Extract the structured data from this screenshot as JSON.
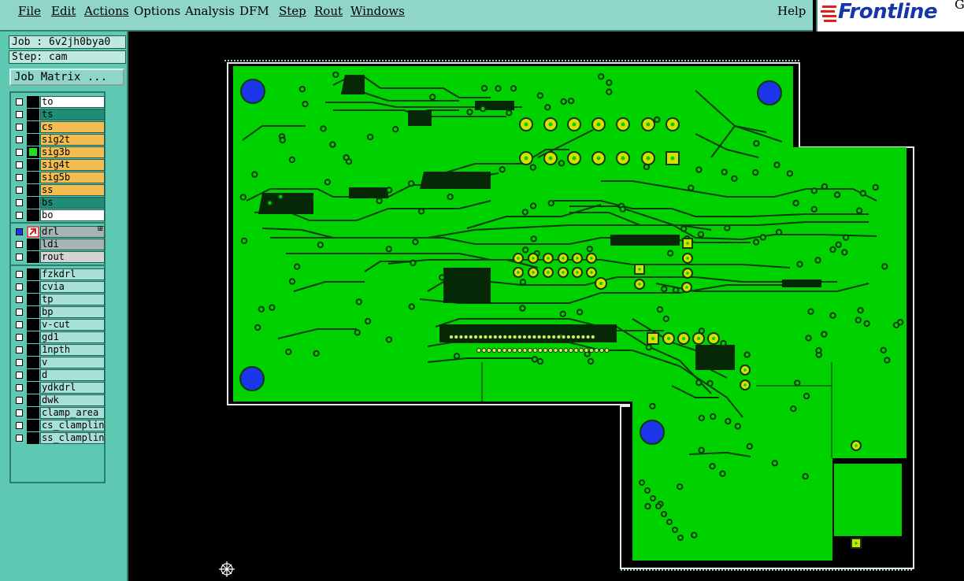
{
  "menu": {
    "file": "File",
    "edit": "Edit",
    "actions": "Actions",
    "options": "Options",
    "analysis": "Analysis",
    "dfm": "DFM",
    "step": "Step",
    "rout": "Rout",
    "windows": "Windows",
    "help": "Help"
  },
  "logo": {
    "text": "Frontline",
    "corner": "G"
  },
  "job": {
    "label": "Job : 6v2jh0bya0",
    "step": "Step: cam",
    "matrix_button": "Job Matrix ..."
  },
  "colors": {
    "board": "#00d200",
    "pad": "#d8e000",
    "hole": "#1a36e8",
    "panel": "#5ec9b3"
  },
  "layers_group1": [
    {
      "name": "to",
      "bg": "#ffffff"
    },
    {
      "name": "ts",
      "bg": "#1f8c78"
    },
    {
      "name": "cs",
      "bg": "#f5bd50"
    },
    {
      "name": "sig2t",
      "bg": "#f5bd50"
    },
    {
      "name": "sig3b",
      "bg": "#f5bd50",
      "active": true
    },
    {
      "name": "sig4t",
      "bg": "#f5bd50"
    },
    {
      "name": "sig5b",
      "bg": "#f5bd50"
    },
    {
      "name": "ss",
      "bg": "#f5bd50"
    },
    {
      "name": "bs",
      "bg": "#1f8c78"
    },
    {
      "name": "bo",
      "bg": "#ffffff"
    }
  ],
  "layers_group2": [
    {
      "name": "drl",
      "bg": "#a7b3b3",
      "selected": true
    },
    {
      "name": "ldi",
      "bg": "#a7b3b3"
    },
    {
      "name": "rout",
      "bg": "#d4d4d4"
    }
  ],
  "layers_group3": [
    {
      "name": "fzkdrl",
      "bg": "#a8dfd6"
    },
    {
      "name": "cvia",
      "bg": "#a8dfd6"
    },
    {
      "name": "tp",
      "bg": "#a8dfd6"
    },
    {
      "name": "bp",
      "bg": "#a8dfd6"
    },
    {
      "name": "v-cut",
      "bg": "#a8dfd6"
    },
    {
      "name": "gd1",
      "bg": "#a8dfd6"
    },
    {
      "name": "1npth",
      "bg": "#a8dfd6"
    },
    {
      "name": "v",
      "bg": "#a8dfd6"
    },
    {
      "name": "d",
      "bg": "#a8dfd6"
    },
    {
      "name": "ydkdrl",
      "bg": "#a8dfd6"
    },
    {
      "name": "dwk",
      "bg": "#a8dfd6"
    },
    {
      "name": "clamp_area",
      "bg": "#a8dfd6"
    },
    {
      "name": "cs_clampline",
      "bg": "#a8dfd6"
    },
    {
      "name": "ss_clampline",
      "bg": "#a8dfd6"
    }
  ]
}
